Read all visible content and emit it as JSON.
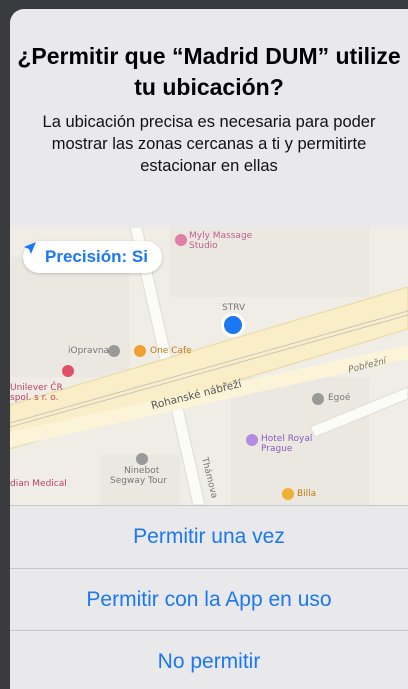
{
  "dialog": {
    "title": "¿Permitir que “Madrid DUM” utilize tu ubicación?",
    "message": "La ubicación precisa es necesaria para poder mostrar las zonas cercanas a ti y permitirte estacionar en ellas"
  },
  "map": {
    "precision_label": "Precisión: Si",
    "labels": {
      "myly": "Myly Massage",
      "studio": "Studio",
      "strv": "STRV",
      "iopravna": "iOpravna",
      "one_cafe": "One Cafe",
      "podbrezni": "Pobřežní",
      "unilever1": "Unilever ČR",
      "unilever2": "spol. s r. o.",
      "rohanske": "Rohanské nábřeží",
      "egoe": "Egoé",
      "hotel1": "Hotel Royal",
      "hotel2": "Prague",
      "ninebot1": "Ninebot",
      "ninebot2": "Segway Tour",
      "thamova": "Thámova",
      "billa": "Billa",
      "medical": "dian Medical"
    },
    "colors": {
      "accent": "#1b77f2",
      "road": "#f9eec7"
    }
  },
  "actions": {
    "allow_once": "Permitir una vez",
    "allow_while_using": "Permitir con la App en uso",
    "deny": "No permitir"
  }
}
